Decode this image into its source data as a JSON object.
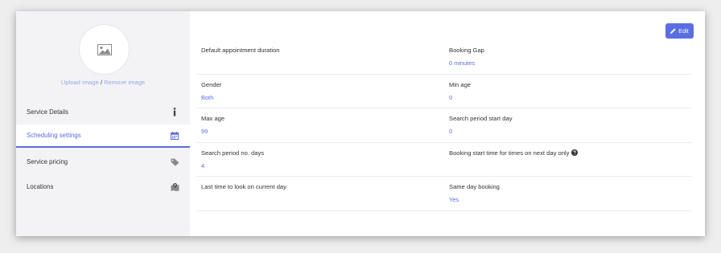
{
  "sidebar": {
    "upload_label": "Upload image",
    "separator": "/",
    "remove_label": "Remove image",
    "items": [
      {
        "label": "Service Details",
        "icon": "info-icon"
      },
      {
        "label": "Scheduling settings",
        "icon": "calendar-icon",
        "active": true
      },
      {
        "label": "Service pricing",
        "icon": "tag-icon"
      },
      {
        "label": "Locations",
        "icon": "map-icon"
      }
    ]
  },
  "main": {
    "edit_label": "Edit",
    "fields": [
      {
        "label": "Default appointment duration",
        "value": ""
      },
      {
        "label": "Booking Gap",
        "value": "0 minutes"
      },
      {
        "label": "Gender",
        "value": "Both"
      },
      {
        "label": "Min age",
        "value": "0"
      },
      {
        "label": "Max age",
        "value": "99"
      },
      {
        "label": "Search period start day",
        "value": "0"
      },
      {
        "label": "Search period no. days",
        "value": "4"
      },
      {
        "label": "Booking start time for times on next day only",
        "value": ""
      },
      {
        "label": "Last time to look on current day",
        "value": ""
      },
      {
        "label": "Same day booking",
        "value": "Yes"
      }
    ]
  },
  "colors": {
    "accent": "#5b6ee1",
    "sidebar_bg": "#f3f3f6",
    "link_light": "#9aa8e6"
  }
}
